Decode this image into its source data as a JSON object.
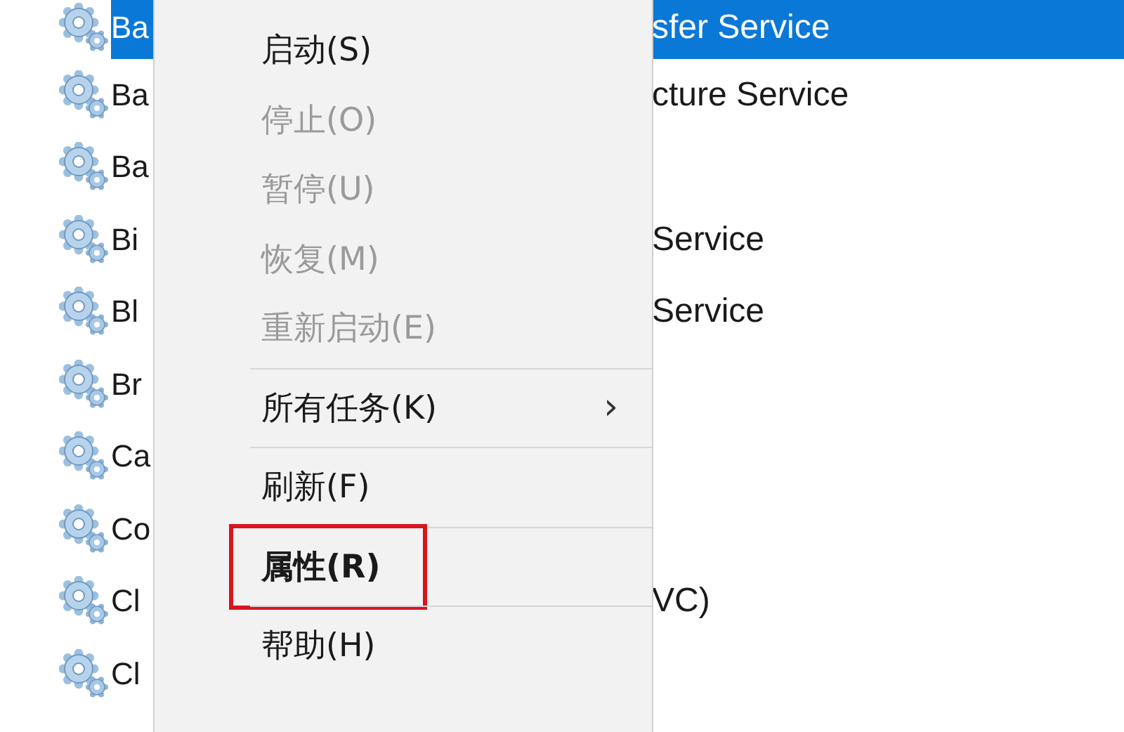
{
  "services": [
    {
      "left": "Ba",
      "right": "sfer Service",
      "selected": true
    },
    {
      "left": "Ba",
      "right": "cture Service",
      "selected": false
    },
    {
      "left": "Ba",
      "selected": false
    },
    {
      "left": "Bi",
      "right": "Service",
      "selected": false
    },
    {
      "left": "Bl",
      "right": "Service",
      "selected": false
    },
    {
      "left": "Br",
      "selected": false
    },
    {
      "left": "Ca",
      "selected": false
    },
    {
      "left": "Co",
      "selected": false
    },
    {
      "left": "Cl",
      "right": "VC)",
      "selected": false
    },
    {
      "left": "Cl",
      "selected": false
    }
  ],
  "context_menu": [
    {
      "kind": "item",
      "label": "启动(S)",
      "disabled": false
    },
    {
      "kind": "item",
      "label": "停止(O)",
      "disabled": true
    },
    {
      "kind": "item",
      "label": "暂停(U)",
      "disabled": true
    },
    {
      "kind": "item",
      "label": "恢复(M)",
      "disabled": true
    },
    {
      "kind": "item",
      "label": "重新启动(E)",
      "disabled": true
    },
    {
      "kind": "separator"
    },
    {
      "kind": "item",
      "label": "所有任务(K)",
      "disabled": false,
      "submenu": "›"
    },
    {
      "kind": "separator"
    },
    {
      "kind": "item",
      "label": "刷新(F)",
      "disabled": false
    },
    {
      "kind": "separator"
    },
    {
      "kind": "item",
      "label": "属性(R)",
      "disabled": false,
      "default": true,
      "outlined": true
    },
    {
      "kind": "separator"
    },
    {
      "kind": "item",
      "label": "帮助(H)",
      "disabled": false
    }
  ]
}
